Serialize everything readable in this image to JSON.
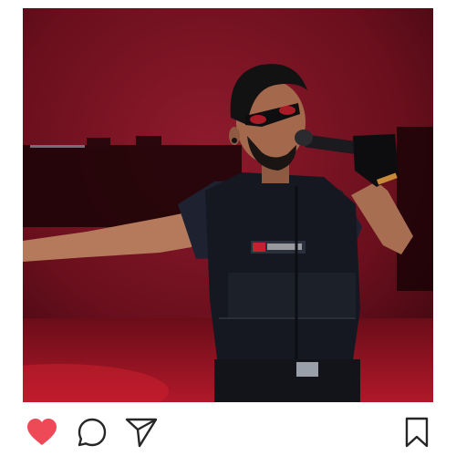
{
  "post": {
    "photo": {
      "subject": "performer-on-stage",
      "background_color": "#7a1220"
    },
    "actions": {
      "like": {
        "icon": "heart-icon",
        "state": "liked",
        "color": "#ed4956"
      },
      "comment": {
        "icon": "comment-icon",
        "color": "#262626"
      },
      "share": {
        "icon": "send-icon",
        "color": "#262626"
      },
      "save": {
        "icon": "bookmark-icon",
        "color": "#262626"
      }
    }
  }
}
